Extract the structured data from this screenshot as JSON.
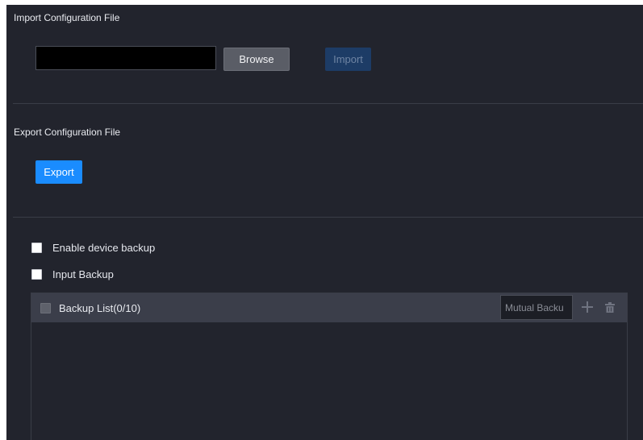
{
  "import": {
    "title": "Import Configuration File",
    "file_value": "",
    "browse_label": "Browse",
    "import_label": "Import"
  },
  "export": {
    "title": "Export Configuration File",
    "export_label": "Export"
  },
  "backup": {
    "enable_device_backup_label": "Enable device backup",
    "input_backup_label": "Input Backup",
    "list_title": "Backup List(0/10)",
    "mode_select_value": "Mutual Backu",
    "icons": [
      "plus-icon",
      "trash-icon"
    ]
  }
}
